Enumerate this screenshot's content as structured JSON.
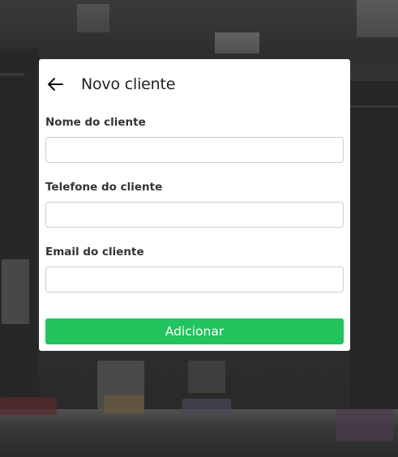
{
  "modal": {
    "title": "Novo cliente",
    "back_icon": "arrow-left-icon"
  },
  "form": {
    "fields": [
      {
        "label": "Nome do cliente",
        "value": "",
        "placeholder": ""
      },
      {
        "label": "Telefone do cliente",
        "value": "",
        "placeholder": ""
      },
      {
        "label": "Email do cliente",
        "value": "",
        "placeholder": ""
      }
    ],
    "submit_label": "Adicionar"
  },
  "colors": {
    "submit_background": "#22c45e",
    "modal_background": "#ffffff",
    "overlay_tint": "#2e2e2e"
  }
}
